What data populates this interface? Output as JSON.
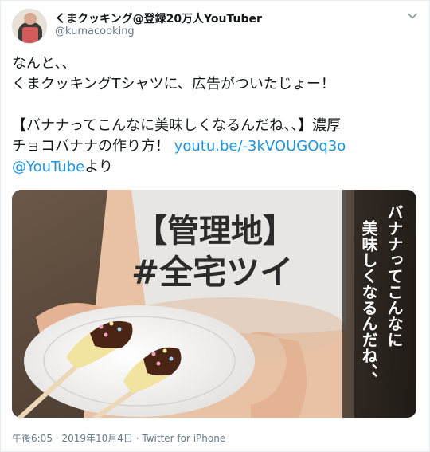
{
  "user": {
    "display_name": "くまクッキング@登録20万人YouTuber",
    "handle": "@kumacooking"
  },
  "tweet": {
    "line1": "なんと、、",
    "line2": "くまクッキングTシャツに、広告がついたじょー！",
    "line3": "【バナナってこんなに美味しくなるんだね、、】濃厚",
    "line4_text": "チョコバナナの作り方！ ",
    "link_url": "youtu.be/-3kVOUGOq3o",
    "mention": "@YouTube",
    "mention_suffix": "より"
  },
  "media": {
    "shirt_text_line1": "【管理地】",
    "shirt_text_line2": "#全宅ツイ",
    "caption_col1": "バナナってこんなに",
    "caption_col2": "美味しくなるんだね、、"
  },
  "footer": {
    "time": "午後6:05",
    "date": "2019年10月4日",
    "separator": "·",
    "source": "Twitter for iPhone"
  }
}
